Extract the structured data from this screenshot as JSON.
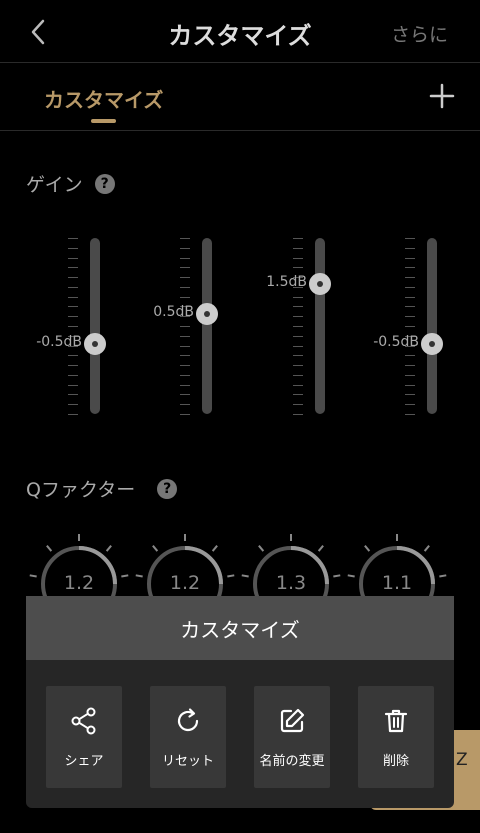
{
  "header": {
    "title": "カスタマイズ",
    "more_label": "さらに"
  },
  "tabs": {
    "active_label": "カスタマイズ"
  },
  "gain": {
    "heading": "ゲイン",
    "help": "?",
    "bands": [
      {
        "value_label": "-0.5dB",
        "level": 0.4
      },
      {
        "value_label": "0.5dB",
        "level": 0.57
      },
      {
        "value_label": "1.5dB",
        "level": 0.74
      },
      {
        "value_label": "-0.5dB",
        "level": 0.4
      }
    ]
  },
  "qfactor": {
    "heading": "Qファクター",
    "help": "?",
    "knobs": [
      {
        "value": "1.2"
      },
      {
        "value": "1.2"
      },
      {
        "value": "1.3"
      },
      {
        "value": "1.1"
      }
    ]
  },
  "underlying": {
    "partial_letter": "Z"
  },
  "sheet": {
    "title": "カスタマイズ",
    "actions": [
      {
        "label": "シェア",
        "icon": "share-icon"
      },
      {
        "label": "リセット",
        "icon": "reset-icon"
      },
      {
        "label": "名前の変更",
        "icon": "edit-icon"
      },
      {
        "label": "削除",
        "icon": "trash-icon"
      }
    ]
  },
  "colors": {
    "accent": "#b89968",
    "background": "#000000",
    "sheet": "#262626",
    "sheet_header": "#4d4d4d"
  }
}
